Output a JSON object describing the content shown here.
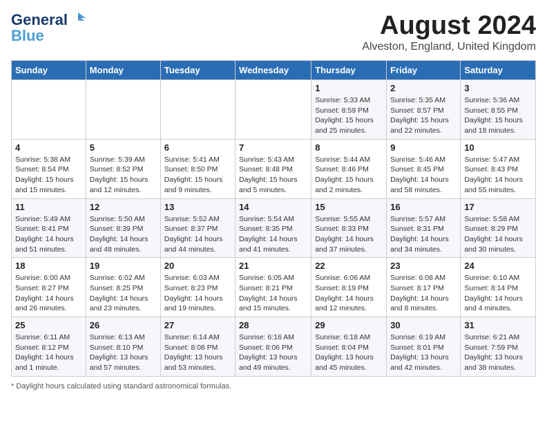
{
  "logo": {
    "line1": "General",
    "line2": "Blue",
    "arrow": "▶"
  },
  "title": "August 2024",
  "location": "Alveston, England, United Kingdom",
  "weekdays": [
    "Sunday",
    "Monday",
    "Tuesday",
    "Wednesday",
    "Thursday",
    "Friday",
    "Saturday"
  ],
  "weeks": [
    [
      {
        "day": "",
        "info": ""
      },
      {
        "day": "",
        "info": ""
      },
      {
        "day": "",
        "info": ""
      },
      {
        "day": "",
        "info": ""
      },
      {
        "day": "1",
        "info": "Sunrise: 5:33 AM\nSunset: 8:59 PM\nDaylight: 15 hours and 25 minutes."
      },
      {
        "day": "2",
        "info": "Sunrise: 5:35 AM\nSunset: 8:57 PM\nDaylight: 15 hours and 22 minutes."
      },
      {
        "day": "3",
        "info": "Sunrise: 5:36 AM\nSunset: 8:55 PM\nDaylight: 15 hours and 18 minutes."
      }
    ],
    [
      {
        "day": "4",
        "info": "Sunrise: 5:38 AM\nSunset: 8:54 PM\nDaylight: 15 hours and 15 minutes."
      },
      {
        "day": "5",
        "info": "Sunrise: 5:39 AM\nSunset: 8:52 PM\nDaylight: 15 hours and 12 minutes."
      },
      {
        "day": "6",
        "info": "Sunrise: 5:41 AM\nSunset: 8:50 PM\nDaylight: 15 hours and 9 minutes."
      },
      {
        "day": "7",
        "info": "Sunrise: 5:43 AM\nSunset: 8:48 PM\nDaylight: 15 hours and 5 minutes."
      },
      {
        "day": "8",
        "info": "Sunrise: 5:44 AM\nSunset: 8:46 PM\nDaylight: 15 hours and 2 minutes."
      },
      {
        "day": "9",
        "info": "Sunrise: 5:46 AM\nSunset: 8:45 PM\nDaylight: 14 hours and 58 minutes."
      },
      {
        "day": "10",
        "info": "Sunrise: 5:47 AM\nSunset: 8:43 PM\nDaylight: 14 hours and 55 minutes."
      }
    ],
    [
      {
        "day": "11",
        "info": "Sunrise: 5:49 AM\nSunset: 8:41 PM\nDaylight: 14 hours and 51 minutes."
      },
      {
        "day": "12",
        "info": "Sunrise: 5:50 AM\nSunset: 8:39 PM\nDaylight: 14 hours and 48 minutes."
      },
      {
        "day": "13",
        "info": "Sunrise: 5:52 AM\nSunset: 8:37 PM\nDaylight: 14 hours and 44 minutes."
      },
      {
        "day": "14",
        "info": "Sunrise: 5:54 AM\nSunset: 8:35 PM\nDaylight: 14 hours and 41 minutes."
      },
      {
        "day": "15",
        "info": "Sunrise: 5:55 AM\nSunset: 8:33 PM\nDaylight: 14 hours and 37 minutes."
      },
      {
        "day": "16",
        "info": "Sunrise: 5:57 AM\nSunset: 8:31 PM\nDaylight: 14 hours and 34 minutes."
      },
      {
        "day": "17",
        "info": "Sunrise: 5:58 AM\nSunset: 8:29 PM\nDaylight: 14 hours and 30 minutes."
      }
    ],
    [
      {
        "day": "18",
        "info": "Sunrise: 6:00 AM\nSunset: 8:27 PM\nDaylight: 14 hours and 26 minutes."
      },
      {
        "day": "19",
        "info": "Sunrise: 6:02 AM\nSunset: 8:25 PM\nDaylight: 14 hours and 23 minutes."
      },
      {
        "day": "20",
        "info": "Sunrise: 6:03 AM\nSunset: 8:23 PM\nDaylight: 14 hours and 19 minutes."
      },
      {
        "day": "21",
        "info": "Sunrise: 6:05 AM\nSunset: 8:21 PM\nDaylight: 14 hours and 15 minutes."
      },
      {
        "day": "22",
        "info": "Sunrise: 6:06 AM\nSunset: 8:19 PM\nDaylight: 14 hours and 12 minutes."
      },
      {
        "day": "23",
        "info": "Sunrise: 6:08 AM\nSunset: 8:17 PM\nDaylight: 14 hours and 8 minutes."
      },
      {
        "day": "24",
        "info": "Sunrise: 6:10 AM\nSunset: 8:14 PM\nDaylight: 14 hours and 4 minutes."
      }
    ],
    [
      {
        "day": "25",
        "info": "Sunrise: 6:11 AM\nSunset: 8:12 PM\nDaylight: 14 hours and 1 minute."
      },
      {
        "day": "26",
        "info": "Sunrise: 6:13 AM\nSunset: 8:10 PM\nDaylight: 13 hours and 57 minutes."
      },
      {
        "day": "27",
        "info": "Sunrise: 6:14 AM\nSunset: 8:08 PM\nDaylight: 13 hours and 53 minutes."
      },
      {
        "day": "28",
        "info": "Sunrise: 6:16 AM\nSunset: 8:06 PM\nDaylight: 13 hours and 49 minutes."
      },
      {
        "day": "29",
        "info": "Sunrise: 6:18 AM\nSunset: 8:04 PM\nDaylight: 13 hours and 45 minutes."
      },
      {
        "day": "30",
        "info": "Sunrise: 6:19 AM\nSunset: 8:01 PM\nDaylight: 13 hours and 42 minutes."
      },
      {
        "day": "31",
        "info": "Sunrise: 6:21 AM\nSunset: 7:59 PM\nDaylight: 13 hours and 38 minutes."
      }
    ]
  ],
  "footer": "Daylight hours"
}
